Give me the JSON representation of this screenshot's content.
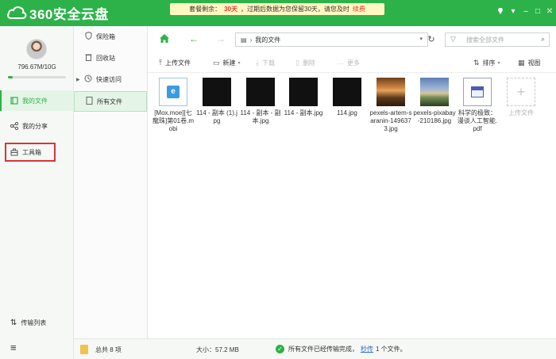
{
  "app": {
    "brand": "360安全云盘",
    "notice": {
      "prefix": "套餐剩余：",
      "days": "30天",
      "middle": "，过期后数据为您保留30天，请您及时",
      "renew": "续费"
    },
    "window_controls": [
      "skin-icon",
      "menu-icon",
      "minimize-icon",
      "maximize-icon",
      "close-icon"
    ]
  },
  "sidebar": {
    "quota_text": "796.67M/10G",
    "quota_fraction": 0.08,
    "items": [
      {
        "label": "我的文件",
        "icon": "folder-icon",
        "active": true
      },
      {
        "label": "我的分享",
        "icon": "share-icon",
        "active": false
      },
      {
        "label": "工具箱",
        "icon": "toolbox-icon",
        "active": false
      }
    ],
    "bottom": {
      "transfer_label": "传输列表"
    }
  },
  "secondary_nav": {
    "items": [
      {
        "label": "保险箱",
        "icon": "shield-icon"
      },
      {
        "label": "回收站",
        "icon": "trash-icon"
      },
      {
        "label": "快速访问",
        "icon": "clock-icon"
      },
      {
        "label": "所有文件",
        "icon": "doc-icon"
      }
    ]
  },
  "address": {
    "path": "我的文件",
    "search_placeholder": "搜索全部文件"
  },
  "toolbar": {
    "upload": "上传文件",
    "new": "新建",
    "download": "下载",
    "delete": "删除",
    "more": "更多",
    "sort": "排序",
    "view": "视图"
  },
  "files": [
    {
      "name": "[Mox.moe][七龍珠]第01卷.mobi",
      "type": "mobi"
    },
    {
      "name": "114 - 副本 (1).jpg",
      "type": "black"
    },
    {
      "name": "114 - 副本 - 副本.jpg",
      "type": "black"
    },
    {
      "name": "114 - 副本.jpg",
      "type": "black"
    },
    {
      "name": "114.jpg",
      "type": "black"
    },
    {
      "name": "pexels-artem-saranin-1496373.jpg",
      "type": "photo1"
    },
    {
      "name": "pexels-pixabay-210186.jpg",
      "type": "photo2"
    },
    {
      "name": "科学的极致：漫谈人工智能.pdf",
      "type": "pdf"
    },
    {
      "name": "上传文件",
      "type": "upload"
    }
  ],
  "status": {
    "total": "总共 8 项",
    "size": "大小：57.2 MB",
    "message_prefix": "所有文件已经传输完成，",
    "message_link": "秒传",
    "message_suffix": "1 个文件。"
  }
}
